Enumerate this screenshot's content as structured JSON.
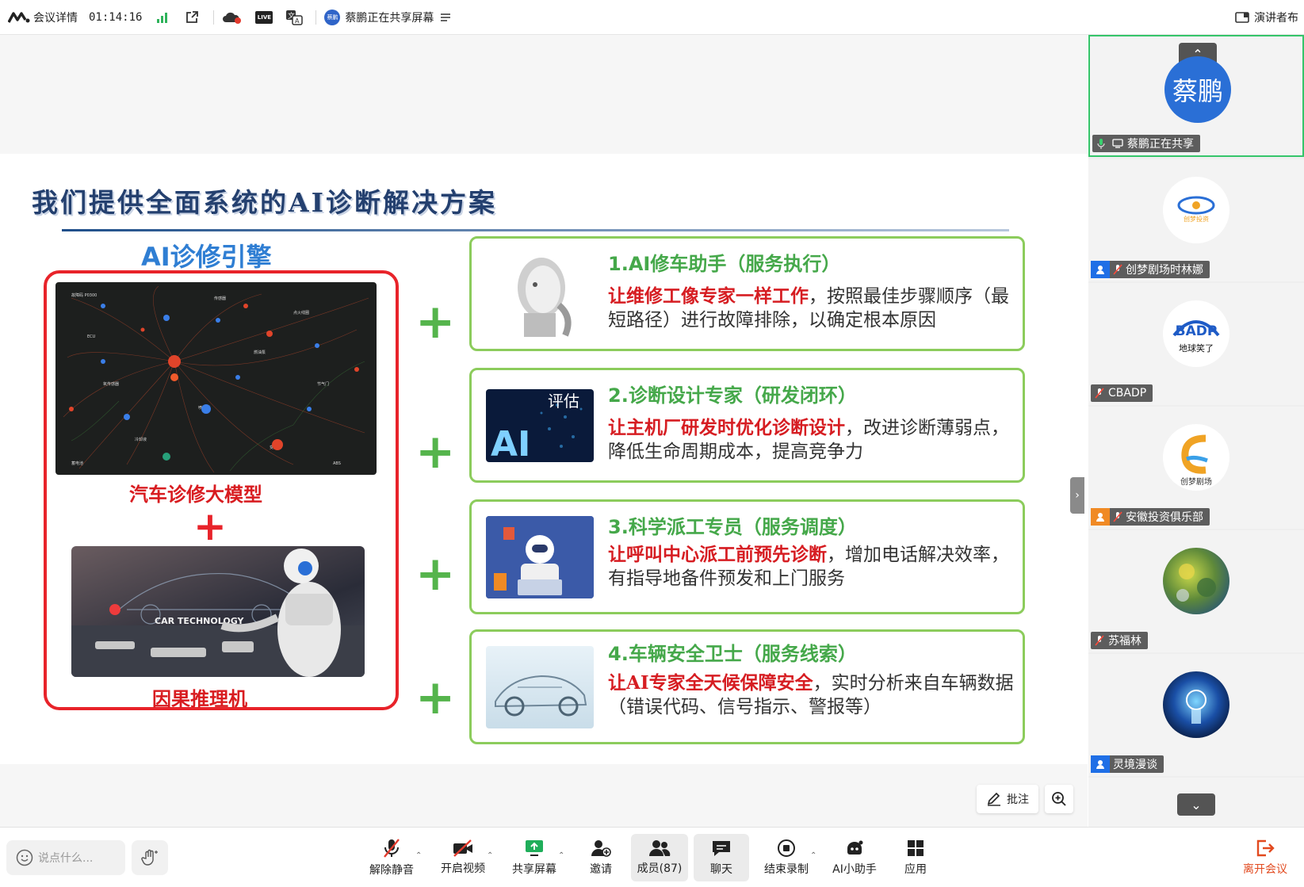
{
  "topbar": {
    "meeting_details": "会议详情",
    "timer": "01:14:16",
    "sharing_status": "蔡鹏正在共享屏幕",
    "live_badge": "LIVE",
    "presenter_view": "演讲者布"
  },
  "slide": {
    "title": "我们提供全面系统的AI诊断解决方案",
    "engine_label": "AI诊修引擎",
    "model_label": "汽车诊修大模型",
    "plus": "+",
    "reasoner_label": "因果推理机",
    "car_tech_text": "CAR TECHNOLOGY",
    "cards": [
      {
        "title": "1.AI修车助手（服务执行）",
        "highlight": "让维修工像专家一样工作",
        "text": "，按照最佳步骤顺序（最短路径）进行故障排除，以确定根本原因"
      },
      {
        "title": "2.诊断设计专家（研发闭环）",
        "highlight": "让主机厂研发时优化诊断设计",
        "text": "，改进诊断薄弱点，降低生命周期成本，提高竞争力",
        "thumb_big": "AI",
        "thumb_small": "评估"
      },
      {
        "title": "3.科学派工专员（服务调度）",
        "highlight": "让呼叫中心派工前预先诊断",
        "text": "，增加电话解决效率，有指导地备件预发和上门服务"
      },
      {
        "title": "4.车辆安全卫士（服务线索）",
        "highlight": "让AI专家全天候保障安全",
        "text": "，实时分析来自车辆数据（错误代码、信号指示、警报等）"
      }
    ]
  },
  "share_tools": {
    "annotate": "批注"
  },
  "participants": [
    {
      "name": "蔡鹏正在共享",
      "avatar_text": "蔡鹏",
      "avatar_color": "#2a6fd6"
    },
    {
      "name": "创梦剧场时林娜",
      "logo_text": "创梦投资"
    },
    {
      "name": "CBADP",
      "logo_text": "BADP",
      "logo_sub": "地球笑了"
    },
    {
      "name": "安徽投资俱乐部",
      "logo_text": "创梦剧场"
    },
    {
      "name": "苏福林"
    },
    {
      "name": "灵境漫谈"
    }
  ],
  "bottombar": {
    "chat_placeholder": "说点什么...",
    "buttons": [
      {
        "label": "解除静音",
        "icon": "mic-muted-icon"
      },
      {
        "label": "开启视频",
        "icon": "video-off-icon"
      },
      {
        "label": "共享屏幕",
        "icon": "share-screen-icon"
      },
      {
        "label": "邀请",
        "icon": "invite-icon"
      },
      {
        "label": "成员(87)",
        "icon": "members-icon"
      },
      {
        "label": "聊天",
        "icon": "chat-icon"
      },
      {
        "label": "结束录制",
        "icon": "record-stop-icon"
      },
      {
        "label": "AI小助手",
        "icon": "ai-assistant-icon"
      },
      {
        "label": "应用",
        "icon": "apps-icon"
      },
      {
        "label": "离开会议",
        "icon": "leave-icon"
      }
    ]
  },
  "colors": {
    "accent_green": "#55b44c",
    "alert_red": "#d61d22",
    "brand_blue": "#2a6fd6",
    "leave": "#e24a1f"
  }
}
